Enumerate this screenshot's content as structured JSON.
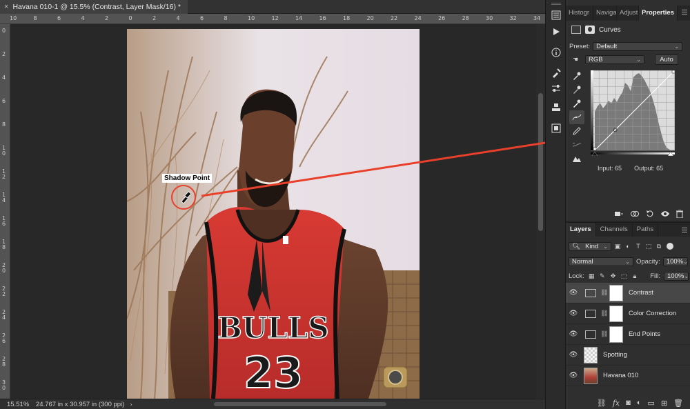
{
  "document": {
    "tab_close": "×",
    "tab_title": "Havana 010-1 @ 15.5% (Contrast, Layer Mask/16) *"
  },
  "rulers": {
    "top_ticks": [
      "10",
      "8",
      "6",
      "4",
      "2",
      "0",
      "2",
      "4",
      "6",
      "8",
      "10",
      "12",
      "14",
      "16",
      "18",
      "20",
      "22",
      "24",
      "26",
      "28",
      "30",
      "32",
      "34"
    ],
    "left_ticks": [
      "0",
      "2",
      "4",
      "6",
      "8",
      "1\n0",
      "1\n2",
      "1\n4",
      "1\n6",
      "1\n8",
      "2\n0",
      "2\n2",
      "2\n4",
      "2\n6",
      "2\n8",
      "3\n0"
    ]
  },
  "annotation": {
    "label": "Shadow Point",
    "color": "#e8402a"
  },
  "status": {
    "zoom": "15.51%",
    "doc_size": "24.767 in x 30.957 in (300 ppi)",
    "arrow": "›"
  },
  "mid_strip": {
    "icons": [
      "history-icon",
      "play-icon",
      "info-icon",
      "brush-settings-icon",
      "adjust-sliders-icon",
      "clone-source-icon",
      "swatches-icon"
    ]
  },
  "properties_panel": {
    "tabs": [
      "Histogr",
      "Navigat",
      "Adjustm",
      "Properties"
    ],
    "active_tab": "Properties",
    "adjustment_name": "Curves",
    "preset_label": "Preset:",
    "preset_value": "Default",
    "channel_value": "RGB",
    "auto_label": "Auto",
    "input_label": "Input:",
    "input_value": "65",
    "output_label": "Output:",
    "output_value": "65",
    "curve_point": {
      "input": 65,
      "output": 65
    }
  },
  "layers_panel": {
    "tabs": [
      "Layers",
      "Channels",
      "Paths"
    ],
    "active_tab": "Layers",
    "filter_kind": "Kind",
    "blend_mode": "Normal",
    "opacity_label": "Opacity:",
    "opacity_value": "100%",
    "lock_label": "Lock:",
    "fill_label": "Fill:",
    "fill_value": "100%",
    "layers": [
      {
        "name": "Contrast",
        "type": "curves",
        "selected": true
      },
      {
        "name": "Color Correction",
        "type": "curves",
        "selected": false
      },
      {
        "name": "End Points",
        "type": "curves",
        "selected": false
      },
      {
        "name": "Spotting",
        "type": "pixel-empty",
        "selected": false
      },
      {
        "name": "Havana 010",
        "type": "photo",
        "selected": false
      }
    ]
  }
}
